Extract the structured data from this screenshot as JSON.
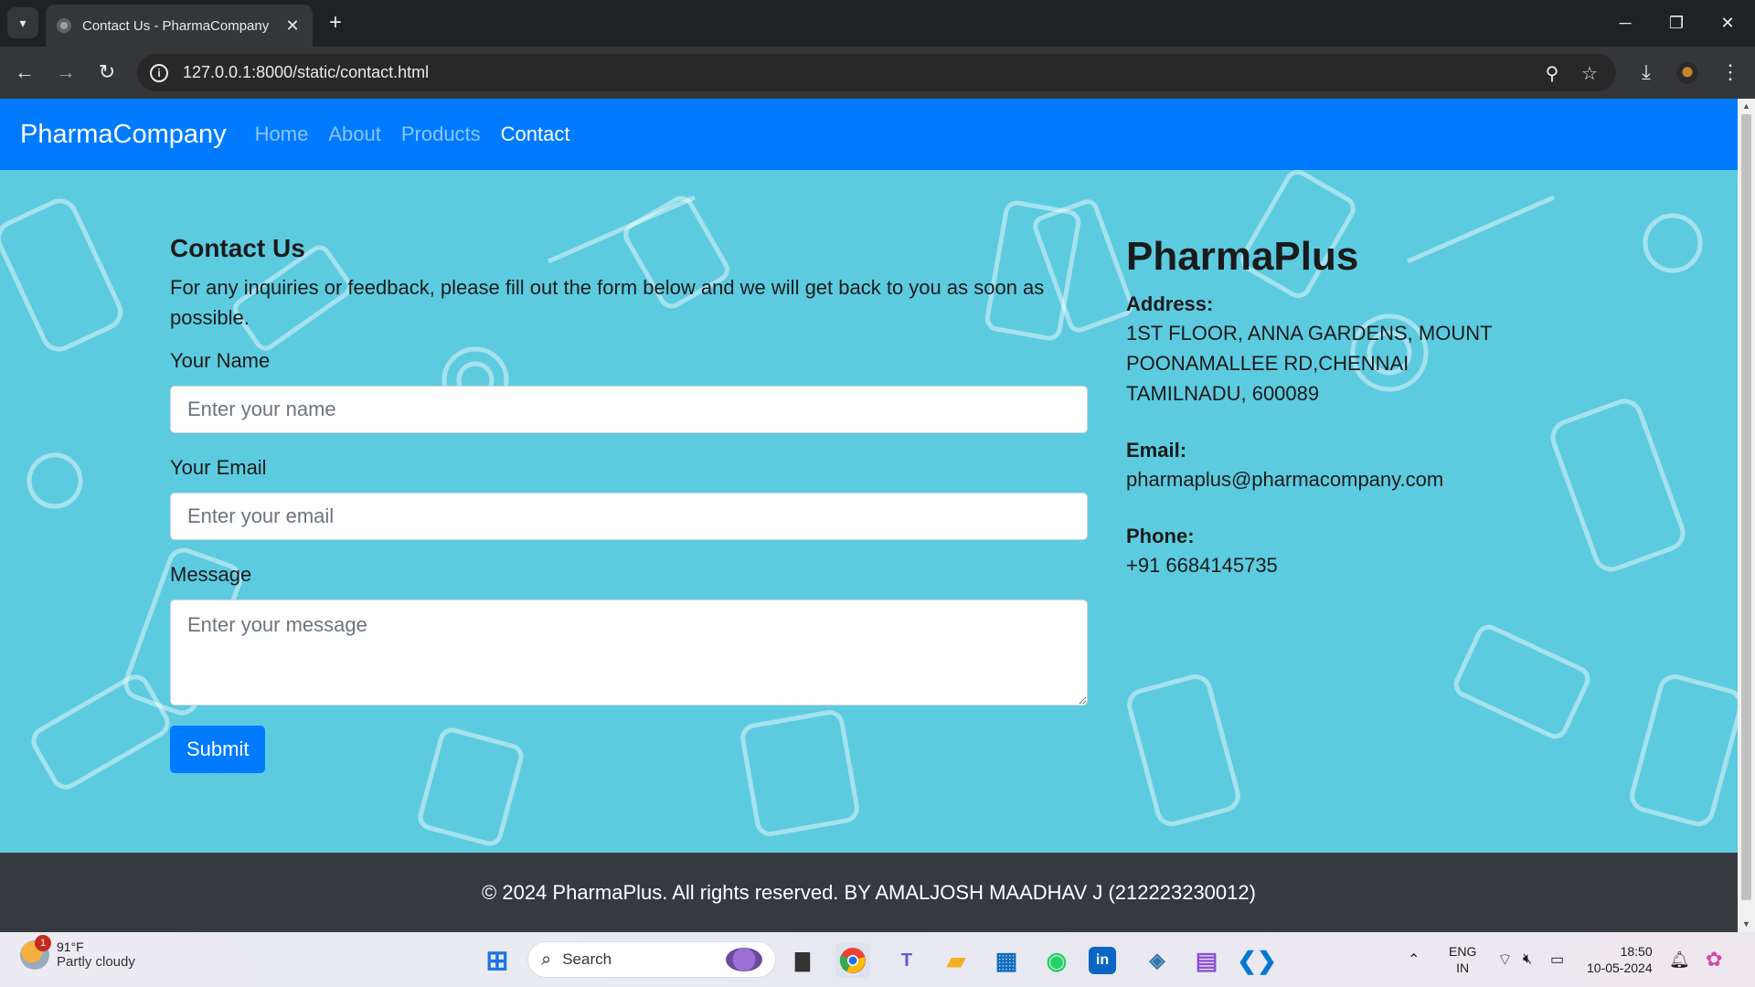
{
  "browser": {
    "tab_title": "Contact Us - PharmaCompany",
    "url": "127.0.0.1:8000/static/contact.html"
  },
  "navbar": {
    "brand": "PharmaCompany",
    "links": [
      "Home",
      "About",
      "Products",
      "Contact"
    ],
    "active": "Contact"
  },
  "contact": {
    "heading": "Contact Us",
    "description": "For any inquiries or feedback, please fill out the form below and we will get back to you as soon as possible.",
    "name_label": "Your Name",
    "name_placeholder": "Enter your name",
    "email_label": "Your Email",
    "email_placeholder": "Enter your email",
    "message_label": "Message",
    "message_placeholder": "Enter your message",
    "submit_label": "Submit"
  },
  "company": {
    "name": "PharmaPlus",
    "address_label": "Address:",
    "address_lines": [
      "1ST FLOOR, ANNA GARDENS, MOUNT",
      "POONAMALLEE RD,CHENNAI",
      "TAMILNADU, 600089"
    ],
    "email_label": "Email:",
    "email": "pharmaplus@pharmacompany.com",
    "phone_label": "Phone:",
    "phone": "+91 6684145735"
  },
  "footer": {
    "text": "© 2024 PharmaPlus. All rights reserved. BY AMALJOSH MAADHAV J (212223230012)"
  },
  "taskbar": {
    "weather_temp": "91°F",
    "weather_desc": "Partly cloudy",
    "weather_badge": "1",
    "search_label": "Search",
    "lang_1": "ENG",
    "lang_2": "IN",
    "time": "18:50",
    "date": "10-05-2024"
  },
  "colors": {
    "navbar": "#007bff",
    "background": "#5ccbe0",
    "footer": "#343a40"
  }
}
